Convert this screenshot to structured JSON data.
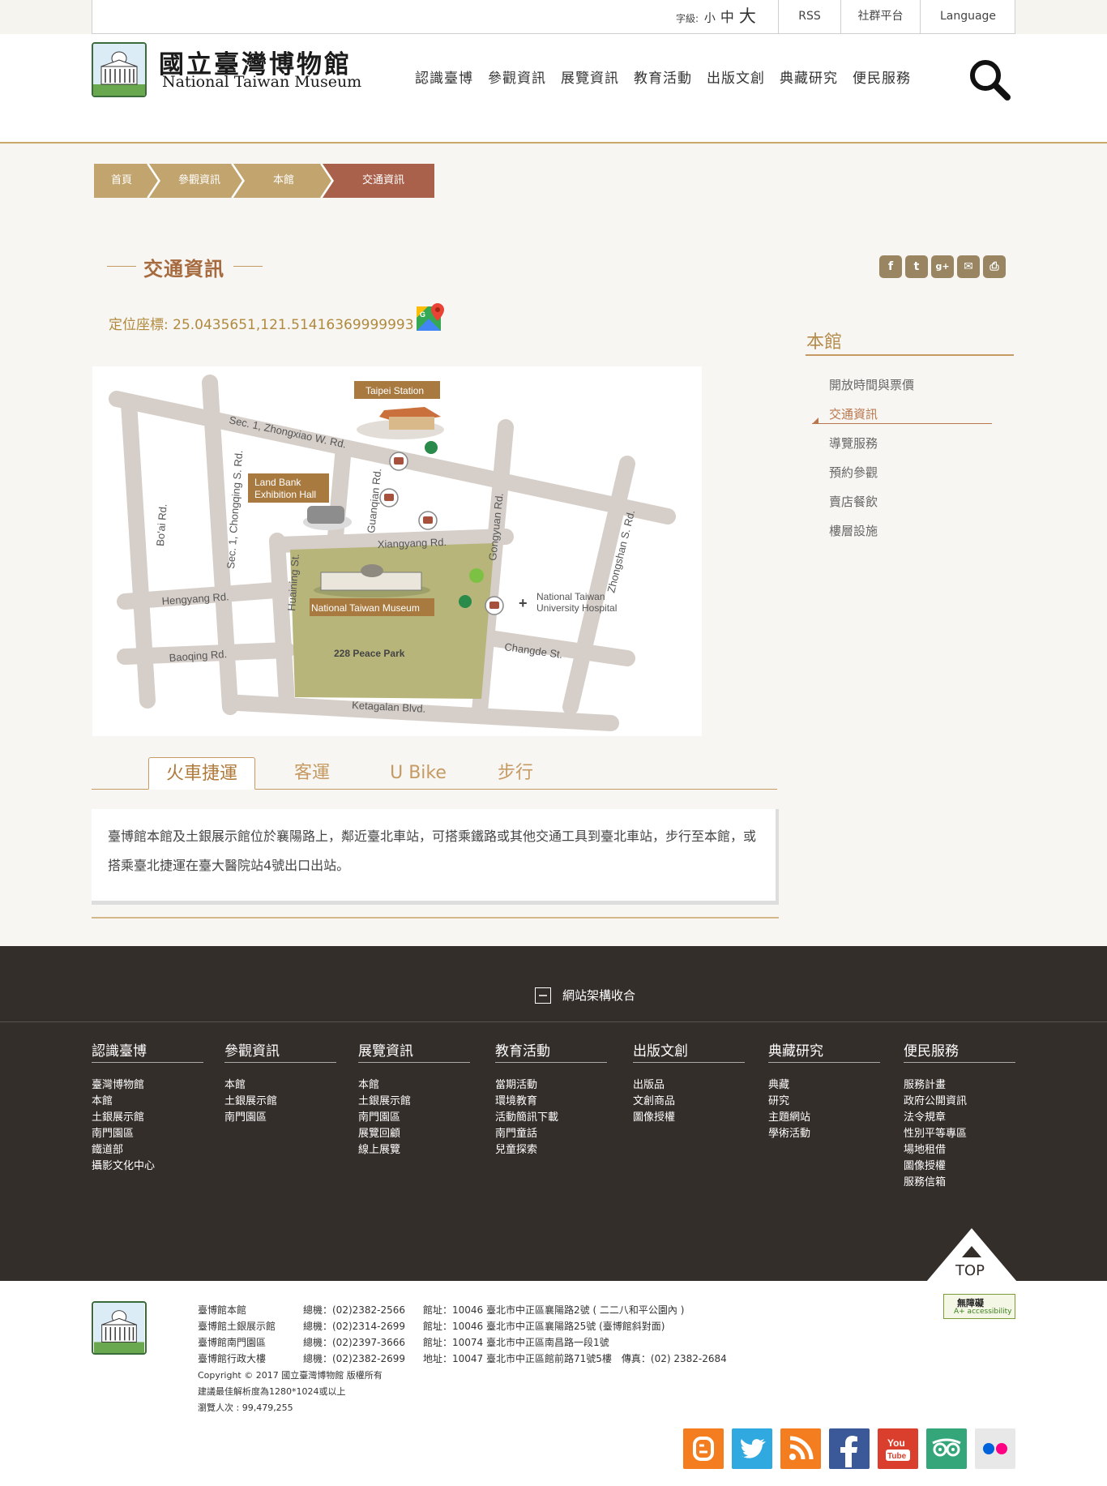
{
  "util": {
    "font_label": "字級:",
    "font_small": "小",
    "font_medium": "中",
    "font_large": "大",
    "rss": "RSS",
    "social": "社群平台",
    "language": "Language"
  },
  "header": {
    "logo_zh": "國立臺灣博物館",
    "logo_en": "National Taiwan Museum",
    "nav": [
      "認識臺博",
      "參觀資訊",
      "展覽資訊",
      "教育活動",
      "出版文創",
      "典藏研究",
      "便民服務"
    ]
  },
  "breadcrumb": [
    "首頁",
    "參觀資訊",
    "本館",
    "交通資訊"
  ],
  "page": {
    "title": "交通資訊",
    "coord_label": "定位座標: 25.0435651,121.51416369999993",
    "share": [
      "f",
      "t",
      "g+",
      "✉",
      "⎙"
    ]
  },
  "map": {
    "taipei_station": "Taipei Station",
    "land_bank": [
      "Land Bank",
      "Exhibition Hall"
    ],
    "ntm": "National Taiwan Museum",
    "park": "228 Peace Park",
    "hospital": [
      "National Taiwan",
      "University Hospital"
    ],
    "roads": {
      "zhongxiao": "Sec. 1, Zhongxiao W. Rd.",
      "chongqing": "Sec. 1, Chongqing S. Rd.",
      "boai": "Bo'ai Rd.",
      "guanqian": "Guanqian Rd.",
      "gongyuan": "Gongyuan Rd.",
      "zhongshan": "Zhongshan S. Rd.",
      "xiangyang": "Xiangyang Rd.",
      "hengyang": "Hengyang Rd.",
      "huaining": "Huaining St.",
      "baoqing": "Baoqing Rd.",
      "changde": "Changde St.",
      "ketagalan": "Ketagalan Blvd."
    }
  },
  "tabs": {
    "items": [
      "火車捷運",
      "客運",
      "U Bike",
      "步行"
    ],
    "active_index": 0,
    "panel_text": "臺博館本館及土銀展示館位於襄陽路上，鄰近臺北車站，可搭乘鐵路或其他交通工具到臺北車站，步行至本館，或搭乘臺北捷運在臺大醫院站4號出口出站。"
  },
  "sidebar": {
    "title": "本館",
    "items": [
      "開放時間與票價",
      "交通資訊",
      "導覽服務",
      "預約參觀",
      "賣店餐飲",
      "樓層設施"
    ],
    "active_index": 1
  },
  "footer": {
    "collapse_label": "網站架構收合",
    "columns": [
      {
        "title": "認識臺博",
        "links": [
          "臺灣博物館",
          "本館",
          "土銀展示館",
          "南門園區",
          "鐵道部",
          "攝影文化中心"
        ]
      },
      {
        "title": "參觀資訊",
        "links": [
          "本館",
          "土銀展示館",
          "南門園區"
        ]
      },
      {
        "title": "展覽資訊",
        "links": [
          "本館",
          "土銀展示館",
          "南門園區",
          "展覽回顧",
          "線上展覽"
        ]
      },
      {
        "title": "教育活動",
        "links": [
          "當期活動",
          "環境教育",
          "活動簡訊下載",
          "南門童話",
          "兒童探索"
        ]
      },
      {
        "title": "出版文創",
        "links": [
          "出版品",
          "文創商品",
          "圖像授權"
        ]
      },
      {
        "title": "典藏研究",
        "links": [
          "典藏",
          "研究",
          "主題網站",
          "學術活動"
        ]
      },
      {
        "title": "便民服務",
        "links": [
          "服務計畫",
          "政府公開資訊",
          "法令規章",
          "性別平等專區",
          "場地租借",
          "圖像授權",
          "服務信箱"
        ]
      }
    ],
    "top_label": "TOP",
    "info_rows": [
      {
        "name": "臺博館本館",
        "tel": "總機：(02)2382-2566",
        "addr": "館址：10046 臺北市中正區襄陽路2號 ( 二二八和平公園內 )"
      },
      {
        "name": "臺博館土銀展示館",
        "tel": "總機：(02)2314-2699",
        "addr": "館址：10046 臺北市中正區襄陽路25號 (臺博館斜對面)"
      },
      {
        "name": "臺博館南門園區",
        "tel": "總機：(02)2397-3666",
        "addr": "館址：10074 臺北市中正區南昌路一段1號"
      },
      {
        "name": "臺博館行政大樓",
        "tel": "總機：(02)2382-2699",
        "addr": "地址：10047 臺北市中正區館前路71號5樓　傳真：(02) 2382-2684"
      }
    ],
    "copyright": "Copyright © 2017  國立臺灣博物館 版權所有",
    "resolution": "建議最佳解析度為1280*1024或以上",
    "visitors": "瀏覽人次 : 99,479,255",
    "a11y_label": "無障礙",
    "a11y_sub": "A+ accessibility",
    "social": [
      "blogger",
      "twitter",
      "rss",
      "facebook",
      "youtube",
      "tripadvisor",
      "flickr"
    ]
  },
  "colors": {
    "accent_gold": "#c59a63",
    "breadcrumb_tan": "#c2a46e",
    "breadcrumb_active": "#a9614b",
    "footer_dark": "#342e2b",
    "title_brown": "#a66a3f"
  }
}
